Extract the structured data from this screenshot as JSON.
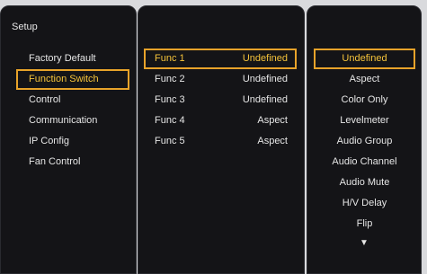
{
  "setup_panel": {
    "title": "Setup",
    "items": [
      {
        "label": "Factory Default"
      },
      {
        "label": "Function Switch"
      },
      {
        "label": "Control"
      },
      {
        "label": "Communication"
      },
      {
        "label": "IP Config"
      },
      {
        "label": "Fan Control"
      }
    ],
    "selected_index": 1
  },
  "function_panel": {
    "rows": [
      {
        "name": "Func 1",
        "value": "Undefined"
      },
      {
        "name": "Func 2",
        "value": "Undefined"
      },
      {
        "name": "Func 3",
        "value": "Undefined"
      },
      {
        "name": "Func 4",
        "value": "Aspect"
      },
      {
        "name": "Func 5",
        "value": "Aspect"
      }
    ],
    "selected_index": 0
  },
  "options_panel": {
    "items": [
      {
        "label": "Undefined"
      },
      {
        "label": "Aspect"
      },
      {
        "label": "Color Only"
      },
      {
        "label": "Levelmeter"
      },
      {
        "label": "Audio Group"
      },
      {
        "label": "Audio Channel"
      },
      {
        "label": "Audio Mute"
      },
      {
        "label": "H/V Delay"
      },
      {
        "label": "Flip"
      }
    ],
    "selected_index": 0,
    "more_indicator": "▼"
  },
  "colors": {
    "panel_bg": "#141417",
    "highlight_border": "#e8a32a",
    "highlight_text": "#f5c33a",
    "text": "#e6e6e6"
  }
}
